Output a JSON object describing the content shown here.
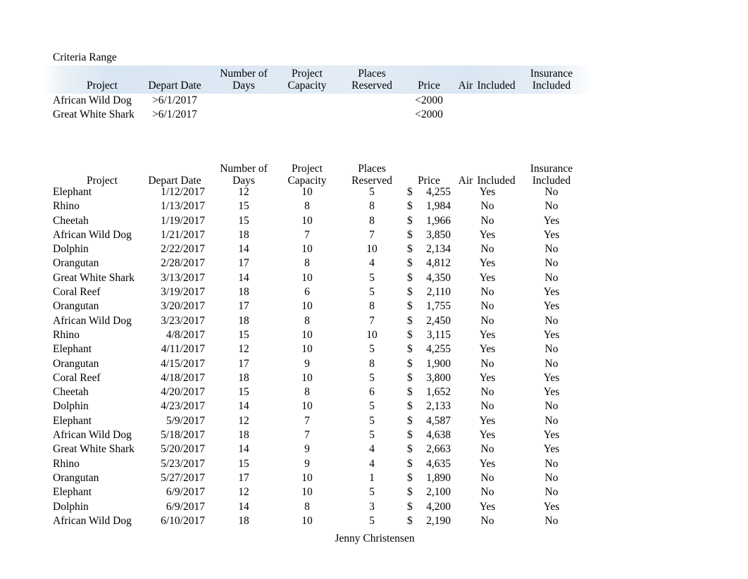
{
  "document": {
    "criteria_label": "Criteria Range",
    "footer_name": "Jenny Christensen",
    "accent_band_color": "#dce6f2"
  },
  "columns": {
    "project": "Project",
    "depart_date": "Depart Date",
    "number_of": "Number of",
    "days": "Days",
    "project_word": "Project",
    "capacity": "Capacity",
    "places": "Places",
    "reserved": "Reserved",
    "price": "Price",
    "air": "Air",
    "included": "Included",
    "insurance": "Insurance",
    "insurance_included": "Included"
  },
  "criteria_range": {
    "rows": [
      {
        "project": "African Wild Dog",
        "depart_date": ">6/1/2017",
        "days": "",
        "capacity": "",
        "places": "",
        "dollar": "",
        "price": "<2000",
        "air": "",
        "insurance": ""
      },
      {
        "project": "Great White Shark",
        "depart_date": ">6/1/2017",
        "days": "",
        "capacity": "",
        "places": "",
        "dollar": "",
        "price": "<2000",
        "air": "",
        "insurance": ""
      }
    ]
  },
  "main_table": {
    "rows": [
      {
        "project": "Elephant",
        "depart_date": "1/12/2017",
        "days": "12",
        "capacity": "10",
        "places": "5",
        "dollar": "$",
        "price": "4,255",
        "air": "Yes",
        "insurance": "No"
      },
      {
        "project": "Rhino",
        "depart_date": "1/13/2017",
        "days": "15",
        "capacity": "8",
        "places": "8",
        "dollar": "$",
        "price": "1,984",
        "air": "No",
        "insurance": "No"
      },
      {
        "project": "Cheetah",
        "depart_date": "1/19/2017",
        "days": "15",
        "capacity": "10",
        "places": "8",
        "dollar": "$",
        "price": "1,966",
        "air": "No",
        "insurance": "Yes"
      },
      {
        "project": "African Wild Dog",
        "depart_date": "1/21/2017",
        "days": "18",
        "capacity": "7",
        "places": "7",
        "dollar": "$",
        "price": "3,850",
        "air": "Yes",
        "insurance": "Yes"
      },
      {
        "project": "Dolphin",
        "depart_date": "2/22/2017",
        "days": "14",
        "capacity": "10",
        "places": "10",
        "dollar": "$",
        "price": "2,134",
        "air": "No",
        "insurance": "No"
      },
      {
        "project": "Orangutan",
        "depart_date": "2/28/2017",
        "days": "17",
        "capacity": "8",
        "places": "4",
        "dollar": "$",
        "price": "4,812",
        "air": "Yes",
        "insurance": "No"
      },
      {
        "project": "Great White Shark",
        "depart_date": "3/13/2017",
        "days": "14",
        "capacity": "10",
        "places": "5",
        "dollar": "$",
        "price": "4,350",
        "air": "Yes",
        "insurance": "No"
      },
      {
        "project": "Coral Reef",
        "depart_date": "3/19/2017",
        "days": "18",
        "capacity": "6",
        "places": "5",
        "dollar": "$",
        "price": "2,110",
        "air": "No",
        "insurance": "Yes"
      },
      {
        "project": "Orangutan",
        "depart_date": "3/20/2017",
        "days": "17",
        "capacity": "10",
        "places": "8",
        "dollar": "$",
        "price": "1,755",
        "air": "No",
        "insurance": "Yes"
      },
      {
        "project": "African Wild Dog",
        "depart_date": "3/23/2017",
        "days": "18",
        "capacity": "8",
        "places": "7",
        "dollar": "$",
        "price": "2,450",
        "air": "No",
        "insurance": "No"
      },
      {
        "project": "Rhino",
        "depart_date": "4/8/2017",
        "days": "15",
        "capacity": "10",
        "places": "10",
        "dollar": "$",
        "price": "3,115",
        "air": "Yes",
        "insurance": "Yes"
      },
      {
        "project": "Elephant",
        "depart_date": "4/11/2017",
        "days": "12",
        "capacity": "10",
        "places": "5",
        "dollar": "$",
        "price": "4,255",
        "air": "Yes",
        "insurance": "No"
      },
      {
        "project": "Orangutan",
        "depart_date": "4/15/2017",
        "days": "17",
        "capacity": "9",
        "places": "8",
        "dollar": "$",
        "price": "1,900",
        "air": "No",
        "insurance": "No"
      },
      {
        "project": "Coral Reef",
        "depart_date": "4/18/2017",
        "days": "18",
        "capacity": "10",
        "places": "5",
        "dollar": "$",
        "price": "3,800",
        "air": "Yes",
        "insurance": "Yes"
      },
      {
        "project": "Cheetah",
        "depart_date": "4/20/2017",
        "days": "15",
        "capacity": "8",
        "places": "6",
        "dollar": "$",
        "price": "1,652",
        "air": "No",
        "insurance": "Yes"
      },
      {
        "project": "Dolphin",
        "depart_date": "4/23/2017",
        "days": "14",
        "capacity": "10",
        "places": "5",
        "dollar": "$",
        "price": "2,133",
        "air": "No",
        "insurance": "No"
      },
      {
        "project": "Elephant",
        "depart_date": "5/9/2017",
        "days": "12",
        "capacity": "7",
        "places": "5",
        "dollar": "$",
        "price": "4,587",
        "air": "Yes",
        "insurance": "No"
      },
      {
        "project": "African Wild Dog",
        "depart_date": "5/18/2017",
        "days": "18",
        "capacity": "7",
        "places": "5",
        "dollar": "$",
        "price": "4,638",
        "air": "Yes",
        "insurance": "Yes"
      },
      {
        "project": "Great White Shark",
        "depart_date": "5/20/2017",
        "days": "14",
        "capacity": "9",
        "places": "4",
        "dollar": "$",
        "price": "2,663",
        "air": "No",
        "insurance": "Yes"
      },
      {
        "project": "Rhino",
        "depart_date": "5/23/2017",
        "days": "15",
        "capacity": "9",
        "places": "4",
        "dollar": "$",
        "price": "4,635",
        "air": "Yes",
        "insurance": "No"
      },
      {
        "project": "Orangutan",
        "depart_date": "5/27/2017",
        "days": "17",
        "capacity": "10",
        "places": "1",
        "dollar": "$",
        "price": "1,890",
        "air": "No",
        "insurance": "No"
      },
      {
        "project": "Elephant",
        "depart_date": "6/9/2017",
        "days": "12",
        "capacity": "10",
        "places": "5",
        "dollar": "$",
        "price": "2,100",
        "air": "No",
        "insurance": "No"
      },
      {
        "project": "Dolphin",
        "depart_date": "6/9/2017",
        "days": "14",
        "capacity": "8",
        "places": "3",
        "dollar": "$",
        "price": "4,200",
        "air": "Yes",
        "insurance": "Yes"
      },
      {
        "project": "African Wild Dog",
        "depart_date": "6/10/2017",
        "days": "18",
        "capacity": "10",
        "places": "5",
        "dollar": "$",
        "price": "2,190",
        "air": "No",
        "insurance": "No"
      }
    ]
  }
}
